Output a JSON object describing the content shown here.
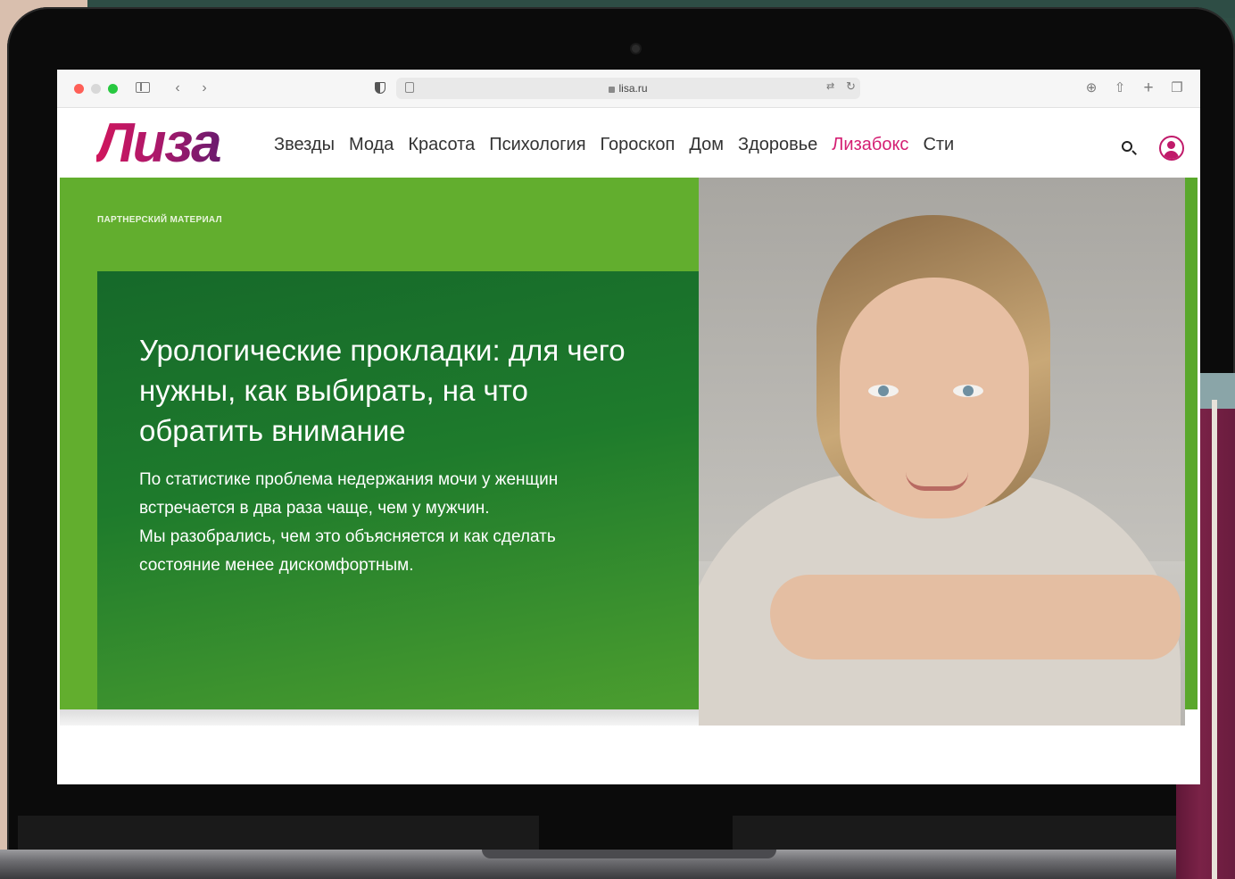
{
  "browser": {
    "url": "lisa.ru"
  },
  "site": {
    "logo": "Лиза",
    "nav": [
      {
        "label": "Звезды"
      },
      {
        "label": "Мода"
      },
      {
        "label": "Красота"
      },
      {
        "label": "Психология"
      },
      {
        "label": "Гороскоп"
      },
      {
        "label": "Дом"
      },
      {
        "label": "Здоровье"
      },
      {
        "label": "Лизабокс"
      },
      {
        "label": "Сти"
      }
    ],
    "accent_color": "#d41f73"
  },
  "hero": {
    "tag": "ПАРТНЕРСКИЙ МАТЕРИАЛ",
    "title": "Урологические прокладки: для чего нужны, как выбирать, на что обратить внимание",
    "lead_line1": "По статистике проблема недержания мочи у женщин встречается в два раза чаще, чем у мужчин.",
    "lead_line2": "Мы разобрались, чем это объясняется и как сделать состояние менее дискомфортным.",
    "green_color": "#62ae2e",
    "card_color": "#16692a"
  }
}
